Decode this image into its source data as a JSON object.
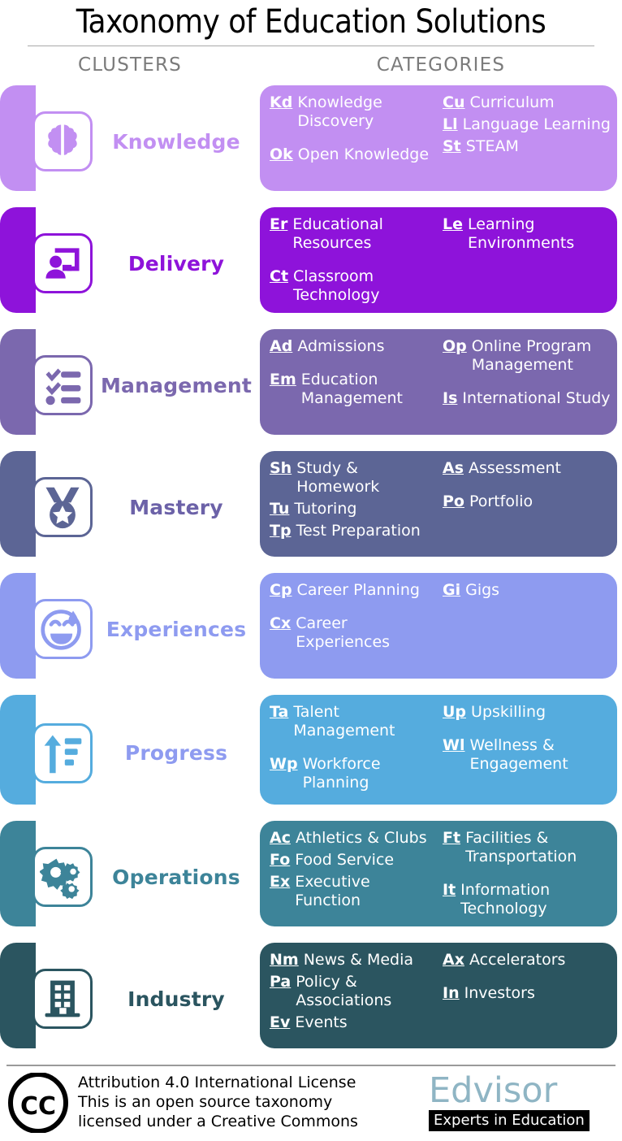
{
  "header": {
    "title": "Taxonomy of Education Solutions",
    "col_clusters": "CLUSTERS",
    "col_categories": "CATEGORIES"
  },
  "clusters": [
    {
      "name": "Knowledge",
      "icon": "brain-icon",
      "bar_color": "#C28FF2",
      "box_color": "#C28FF2",
      "label_color": "#C28FF2",
      "left": [
        {
          "abbr": "Kd",
          "name": "Knowledge Discovery"
        },
        {
          "abbr": "Ok",
          "name": "Open Knowledge"
        }
      ],
      "right": [
        {
          "abbr": "Cu",
          "name": "Curriculum"
        },
        {
          "abbr": "Ll",
          "name": "Language Learning"
        },
        {
          "abbr": "St",
          "name": "STEAM"
        }
      ]
    },
    {
      "name": "Delivery",
      "icon": "presentation-person-icon",
      "bar_color": "#8E13DA",
      "box_color": "#8E13DA",
      "label_color": "#8E13DA",
      "left": [
        {
          "abbr": "Er",
          "name": "Educational Resources"
        },
        {
          "abbr": "Ct",
          "name": "Classroom Technology"
        }
      ],
      "right": [
        {
          "abbr": "Le",
          "name": "Learning Environments"
        }
      ]
    },
    {
      "name": "Management",
      "icon": "checklist-icon",
      "bar_color": "#7B68AE",
      "box_color": "#7B68AE",
      "label_color": "#7B68AE",
      "left": [
        {
          "abbr": "Ad",
          "name": "Admissions"
        },
        {
          "abbr": "Em",
          "name": "Education Management"
        }
      ],
      "right": [
        {
          "abbr": "Op",
          "name": "Online Program Management"
        },
        {
          "abbr": "Is",
          "name": "International Study"
        }
      ]
    },
    {
      "name": "Mastery",
      "icon": "medal-icon",
      "bar_color": "#5C6595",
      "box_color": "#5C6595",
      "label_color": "#6C62A8",
      "left": [
        {
          "abbr": "Sh",
          "name": "Study & Homework"
        },
        {
          "abbr": "Tu",
          "name": "Tutoring"
        },
        {
          "abbr": "Tp",
          "name": "Test Preparation"
        }
      ],
      "right": [
        {
          "abbr": "As",
          "name": "Assessment"
        },
        {
          "abbr": "Po",
          "name": "Portfolio"
        }
      ]
    },
    {
      "name": "Experiences",
      "icon": "smiley-face-icon",
      "bar_color": "#8E9BF0",
      "box_color": "#8E9BF0",
      "label_color": "#8E9BF0",
      "left": [
        {
          "abbr": "Cp",
          "name": "Career Planning"
        },
        {
          "abbr": "Cx",
          "name": "Career Experiences"
        }
      ],
      "right": [
        {
          "abbr": "Gi",
          "name": "Gigs"
        }
      ]
    },
    {
      "name": "Progress",
      "icon": "arrow-up-chart-icon",
      "bar_color": "#55ACDE",
      "box_color": "#55ACDE",
      "label_color": "#8E9BF0",
      "left": [
        {
          "abbr": "Ta",
          "name": "Talent Management"
        },
        {
          "abbr": "Wp",
          "name": "Workforce Planning"
        }
      ],
      "right": [
        {
          "abbr": "Up",
          "name": "Upskilling"
        },
        {
          "abbr": "Wl",
          "name": "Wellness & Engagement"
        }
      ]
    },
    {
      "name": "Operations",
      "icon": "gears-icon",
      "bar_color": "#3D8499",
      "box_color": "#3D8499",
      "label_color": "#3D8499",
      "left": [
        {
          "abbr": "Ac",
          "name": "Athletics & Clubs"
        },
        {
          "abbr": "Fo",
          "name": "Food Service"
        },
        {
          "abbr": "Ex",
          "name": "Executive Function"
        }
      ],
      "right": [
        {
          "abbr": "Ft",
          "name": "Facilities & Transportation"
        },
        {
          "abbr": "It",
          "name": "Information Technology"
        }
      ]
    },
    {
      "name": "Industry",
      "icon": "office-building-icon",
      "bar_color": "#2B5560",
      "box_color": "#2B5560",
      "label_color": "#2B5560",
      "left": [
        {
          "abbr": "Nm",
          "name": "News & Media"
        },
        {
          "abbr": "Pa",
          "name": "Policy & Associations"
        },
        {
          "abbr": "Ev",
          "name": "Events"
        }
      ],
      "right": [
        {
          "abbr": "Ax",
          "name": "Accelerators"
        },
        {
          "abbr": "In",
          "name": "Investors"
        }
      ]
    }
  ],
  "footer": {
    "cc_icon": "creative-commons-icon",
    "license_line1": "Attribution 4.0 International License",
    "license_line2": "This is an open source taxonomy",
    "license_line3": "licensed under a Creative Commons",
    "brand_name": "Edvisor",
    "brand_tagline": "Experts in Education",
    "brand_color": "#8FB5C4"
  }
}
